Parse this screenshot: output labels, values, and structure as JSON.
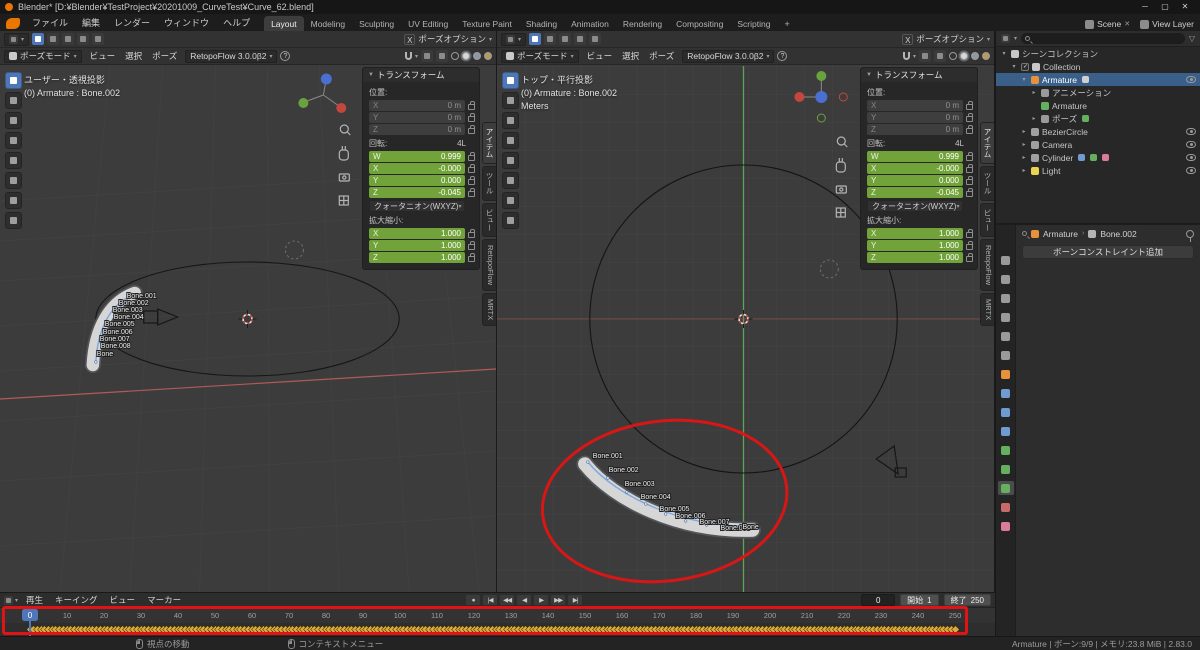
{
  "colors": {
    "keyframe": "#e0a93e",
    "annotation": "#e01414",
    "field-green": "#72a33b",
    "accent-blue": "#4f76b8",
    "row-select": "#3a6089"
  },
  "window": {
    "title": "Blender* [D:¥Blender¥TestProject¥20201009_CurveTest¥Curve_62.blend]",
    "controls": [
      {
        "name": "minimize-button",
        "glyph": "─"
      },
      {
        "name": "maximize-button",
        "glyph": "▢"
      },
      {
        "name": "close-button",
        "glyph": "✕"
      }
    ]
  },
  "topbar": {
    "menus": [
      "ファイル",
      "編集",
      "レンダー",
      "ウィンドウ",
      "ヘルプ"
    ],
    "workspaces": [
      "Layout",
      "Modeling",
      "Sculpting",
      "UV Editing",
      "Texture Paint",
      "Shading",
      "Animation",
      "Rendering",
      "Compositing",
      "Scripting"
    ],
    "active_workspace": "Layout",
    "plus_label": "+",
    "scene_label": "Scene",
    "view_layer_label": "View Layer"
  },
  "viewport_header": {
    "mode": "ポーズモード",
    "menus": [
      "ビュー",
      "選択",
      "ポーズ"
    ],
    "addon": "RetopoFlow 3.0.0β2",
    "help_label": "?",
    "mirror_label": "X",
    "options": "ポーズオプション"
  },
  "viewport_left": {
    "view_label": "ユーザー・透視投影",
    "object_label": "(0) Armature : Bone.002"
  },
  "viewport_right": {
    "view_label": "トップ・平行投影",
    "object_label": "(0) Armature : Bone.002",
    "unit_label": "Meters"
  },
  "side_tabs": [
    "アイテム",
    "ツール",
    "ビュー",
    "RetopoFlow",
    "MRTX"
  ],
  "viewport_tools": [
    {
      "name": "tweak-select-tool",
      "active": true
    },
    {
      "name": "cursor-tool"
    },
    {
      "name": "move-tool"
    },
    {
      "name": "rotate-tool"
    },
    {
      "name": "scale-tool"
    },
    {
      "name": "transform-tool"
    },
    {
      "name": "annotate-tool"
    },
    {
      "name": "measure-tool"
    }
  ],
  "transform": {
    "title": "トランスフォーム",
    "location_label": "位置:",
    "location": [
      {
        "axis": "X",
        "value": "0 m"
      },
      {
        "axis": "Y",
        "value": "0 m"
      },
      {
        "axis": "Z",
        "value": "0 m"
      }
    ],
    "rotation_label": "回転:",
    "rotation_badge": "4L",
    "rotation": [
      {
        "axis": "W",
        "value": "0.999"
      },
      {
        "axis": "X",
        "value": "-0.000"
      },
      {
        "axis": "Y",
        "value": "0.000"
      },
      {
        "axis": "Z",
        "value": "-0.045"
      }
    ],
    "rotation_mode": "クォータニオン(WXYZ)",
    "scale_label": "拡大縮小:",
    "scale": [
      {
        "axis": "X",
        "value": "1.000"
      },
      {
        "axis": "Y",
        "value": "1.000"
      },
      {
        "axis": "Z",
        "value": "1.000"
      }
    ]
  },
  "bones": [
    "Bone.001",
    "Bone.002",
    "Bone.003",
    "Bone.004",
    "Bone.005",
    "Bone.006",
    "Bone.007",
    "Bone.008",
    "Bone"
  ],
  "outliner": {
    "rows": [
      {
        "label": "シーンコレクション",
        "depth": 0,
        "icon": "scene-collection",
        "icon_color": "#c8c8c8",
        "expand": "▾"
      },
      {
        "label": "Collection",
        "depth": 1,
        "icon": "collection",
        "icon_color": "#c8c8c8",
        "expand": "▾",
        "checkbox": true
      },
      {
        "label": "Armature",
        "depth": 2,
        "icon": "armature-object",
        "icon_color": "#e8913c",
        "expand": "▾",
        "selected": true,
        "eye": true,
        "badges": [
          {
            "name": "pose-mode-badge",
            "color": "#cfcfcf"
          }
        ]
      },
      {
        "label": "アニメーション",
        "depth": 3,
        "icon": "animation",
        "icon_color": "#9a9a9a",
        "expand": "▸"
      },
      {
        "label": "Armature",
        "depth": 3,
        "icon": "armature-data",
        "icon_color": "#65b05f",
        "expand": ""
      },
      {
        "label": "ポーズ",
        "depth": 3,
        "icon": "pose",
        "icon_color": "#9a9a9a",
        "expand": "▸",
        "badges": [
          {
            "name": "in-use-badge",
            "color": "#65b05f"
          }
        ]
      },
      {
        "label": "BezierCircle",
        "depth": 2,
        "icon": "curve",
        "icon_color": "#a0a0a0",
        "expand": "▸",
        "eye": true
      },
      {
        "label": "Camera",
        "depth": 2,
        "icon": "camera",
        "icon_color": "#a0a0a0",
        "expand": "▸",
        "eye": true
      },
      {
        "label": "Cylinder",
        "depth": 2,
        "icon": "mesh",
        "icon_color": "#a0a0a0",
        "expand": "▸",
        "eye": true,
        "badges": [
          {
            "name": "modifier-badge",
            "color": "#6f9bd1"
          },
          {
            "name": "mesh-data-badge",
            "color": "#65b05f"
          },
          {
            "name": "material-badge",
            "color": "#d97b9a"
          }
        ]
      },
      {
        "label": "Light",
        "depth": 2,
        "icon": "light",
        "icon_color": "#e8d44d",
        "expand": "▸",
        "eye": true
      }
    ]
  },
  "properties": {
    "breadcrumb": [
      "Armature",
      "Bone.002"
    ],
    "add_constraint": "ボーンコンストレイント追加",
    "tabs": [
      {
        "name": "tool",
        "color": "#9a9a9a"
      },
      {
        "name": "render",
        "color": "#9a9a9a"
      },
      {
        "name": "output",
        "color": "#9a9a9a"
      },
      {
        "name": "view-layer",
        "color": "#9a9a9a"
      },
      {
        "name": "scene",
        "color": "#9a9a9a"
      },
      {
        "name": "world",
        "color": "#9a9a9a"
      },
      {
        "name": "object",
        "color": "#e8913c"
      },
      {
        "name": "modifiers",
        "color": "#6f9bd1"
      },
      {
        "name": "physics",
        "color": "#6f9bd1"
      },
      {
        "name": "object-constraints",
        "color": "#6f9bd1"
      },
      {
        "name": "object-data",
        "color": "#65b05f"
      },
      {
        "name": "bone",
        "color": "#65b05f"
      },
      {
        "name": "bone-constraint",
        "color": "#65b05f",
        "active": true
      },
      {
        "name": "material",
        "color": "#c96a6a"
      },
      {
        "name": "texture",
        "color": "#d97b9a"
      }
    ]
  },
  "timeline": {
    "menus": [
      "再生",
      "キーイング",
      "ビュー",
      "マーカー"
    ],
    "transport": [
      {
        "name": "auto-keying-toggle",
        "glyph": "●"
      },
      {
        "name": "jump-to-start-button",
        "glyph": "|◀"
      },
      {
        "name": "previous-keyframe-button",
        "glyph": "◀◀"
      },
      {
        "name": "play-reverse-button",
        "glyph": "◀"
      },
      {
        "name": "play-button",
        "glyph": "▶"
      },
      {
        "name": "next-keyframe-button",
        "glyph": "▶▶"
      },
      {
        "name": "jump-to-end-button",
        "glyph": "▶|"
      }
    ],
    "current_frame": "0",
    "start_label": "開始",
    "start_value": "1",
    "end_label": "終了",
    "end_value": "250",
    "tick_step": 10,
    "tick_max": 250,
    "keyframes": {
      "first": 0,
      "last": 250
    }
  },
  "statusbar": {
    "hints": [
      {
        "label": "視点の移動"
      },
      {
        "label": "コンテキストメニュー"
      }
    ],
    "info": "Armature | ボーン:9/9 | メモリ:23.8 MiB | 2.83.0"
  }
}
